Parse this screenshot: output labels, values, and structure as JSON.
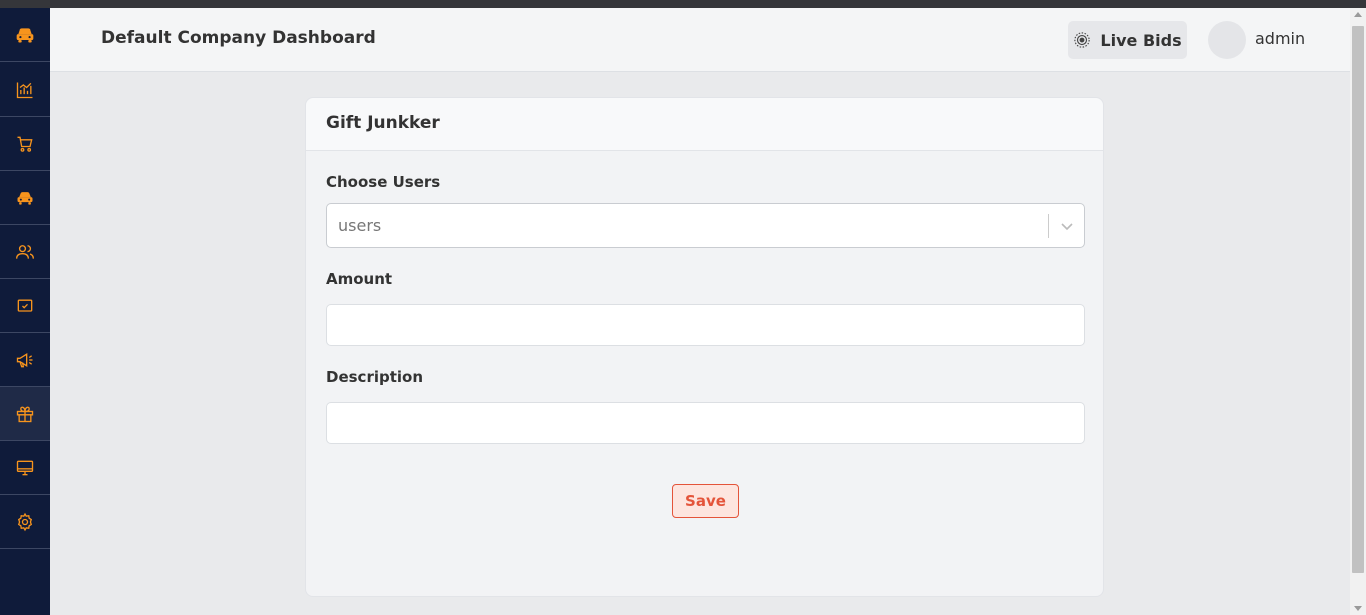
{
  "header": {
    "title": "Default Company Dashboard",
    "live_bids_label": "Live Bids",
    "user_name": "admin"
  },
  "sidebar": {
    "items": [
      {
        "icon": "car-logo-icon"
      },
      {
        "icon": "chart-icon"
      },
      {
        "icon": "cart-icon"
      },
      {
        "icon": "car-icon"
      },
      {
        "icon": "users-icon"
      },
      {
        "icon": "monitor-check-icon"
      },
      {
        "icon": "megaphone-icon"
      },
      {
        "icon": "gift-icon",
        "active": true
      },
      {
        "icon": "desktop-icon"
      },
      {
        "icon": "gear-icon"
      }
    ]
  },
  "form": {
    "title": "Gift Junkker",
    "users_label": "Choose Users",
    "users_placeholder": "users",
    "amount_label": "Amount",
    "amount_value": "",
    "description_label": "Description",
    "description_value": "",
    "save_label": "Save"
  },
  "colors": {
    "sidebar_bg": "#0f1b3a",
    "accent": "#f7941d",
    "save_accent": "#e4543a"
  }
}
